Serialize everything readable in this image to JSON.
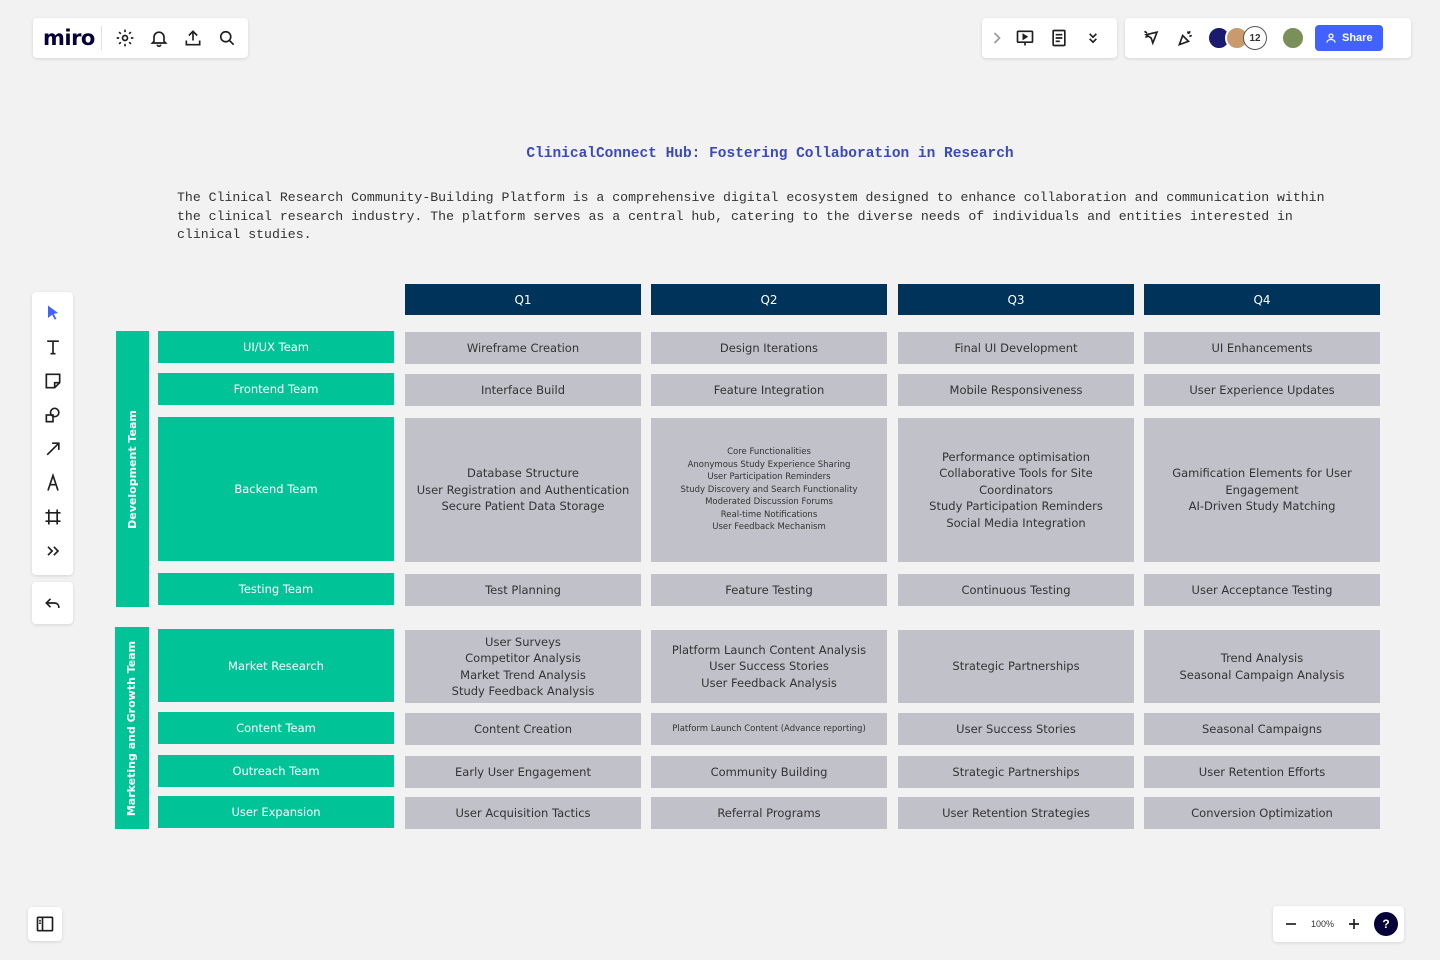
{
  "app": {
    "logo": "miro"
  },
  "toolbar": {
    "share_label": "Share",
    "collaborator_count": "12",
    "zoom_level": "100%",
    "help_label": "?",
    "colors": {
      "accent": "#4262ff",
      "header": "#003359",
      "team": "#00c497",
      "task": "#c1c1c9"
    }
  },
  "board": {
    "title": "ClinicalConnect Hub: Fostering Collaboration in Research",
    "description": "The Clinical Research Community-Building Platform is a comprehensive digital ecosystem designed to enhance collaboration and communication within the clinical research industry. The platform serves as a central hub, catering to the diverse needs of individuals and entities interested in clinical studies.",
    "quarters": [
      "Q1",
      "Q2",
      "Q3",
      "Q4"
    ],
    "groups": [
      {
        "name": "Development Team",
        "teams": [
          {
            "name": "UI/UX Team",
            "tasks": [
              "Wireframe Creation",
              "Design Iterations",
              "Final UI Development",
              "UI Enhancements"
            ]
          },
          {
            "name": "Frontend Team",
            "tasks": [
              "Interface Build",
              "Feature Integration",
              "Mobile Responsiveness",
              "User Experience Updates"
            ]
          },
          {
            "name": "Backend Team",
            "tasks": [
              "Database Structure\nUser Registration and Authentication\nSecure Patient Data Storage",
              "Core Functionalities\nAnonymous Study Experience Sharing\nUser Participation Reminders\nStudy Discovery and Search Functionality\nModerated Discussion Forums\nReal-time Notifications\nUser Feedback Mechanism",
              "Performance optimisation\nCollaborative Tools for Site Coordinators\nStudy Participation Reminders\nSocial Media Integration",
              "Gamification Elements for User Engagement\nAI-Driven Study Matching"
            ]
          },
          {
            "name": "Testing Team",
            "tasks": [
              "Test Planning",
              "Feature Testing",
              "Continuous Testing",
              "User Acceptance Testing"
            ]
          }
        ]
      },
      {
        "name": "Marketing and Growth Team",
        "teams": [
          {
            "name": "Market Research",
            "tasks": [
              "User Surveys\nCompetitor Analysis\nMarket Trend Analysis\nStudy Feedback Analysis",
              "Platform Launch Content Analysis\nUser Success Stories\nUser Feedback Analysis",
              "Strategic Partnerships",
              "Trend Analysis\nSeasonal Campaign Analysis"
            ]
          },
          {
            "name": "Content Team",
            "tasks": [
              "Content Creation",
              "Platform Launch Content (Advance reporting)",
              "User Success Stories",
              "Seasonal Campaigns"
            ]
          },
          {
            "name": "Outreach Team",
            "tasks": [
              "Early User Engagement",
              "Community Building",
              "Strategic Partnerships",
              "User Retention Efforts"
            ]
          },
          {
            "name": "User Expansion",
            "tasks": [
              "User Acquisition Tactics",
              "Referral Programs",
              "User Retention Strategies",
              "Conversion Optimization"
            ]
          }
        ]
      }
    ]
  }
}
